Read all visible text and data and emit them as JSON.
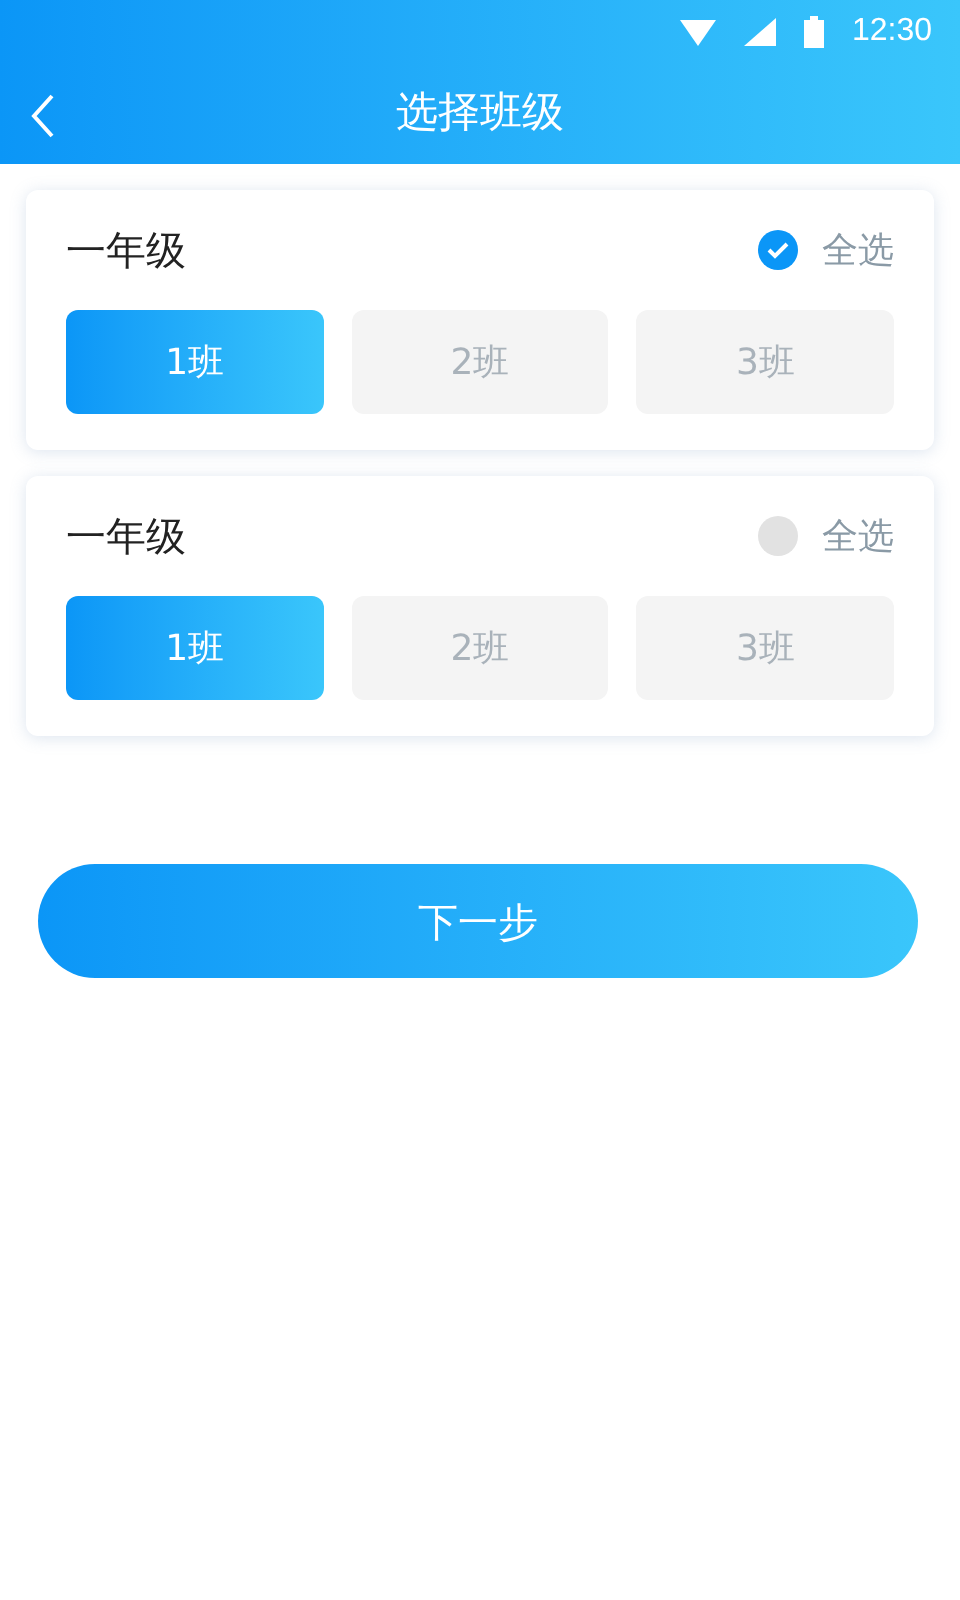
{
  "status_bar": {
    "time": "12:30"
  },
  "header": {
    "title": "选择班级"
  },
  "grades": [
    {
      "name": "一年级",
      "select_all": {
        "label": "全选",
        "checked": true
      },
      "classes": [
        {
          "label": "1班",
          "selected": true
        },
        {
          "label": "2班",
          "selected": false
        },
        {
          "label": "3班",
          "selected": false
        }
      ]
    },
    {
      "name": "一年级",
      "select_all": {
        "label": "全选",
        "checked": false
      },
      "classes": [
        {
          "label": "1班",
          "selected": true
        },
        {
          "label": "2班",
          "selected": false
        },
        {
          "label": "3班",
          "selected": false
        }
      ]
    }
  ],
  "next_button": {
    "label": "下一步"
  }
}
